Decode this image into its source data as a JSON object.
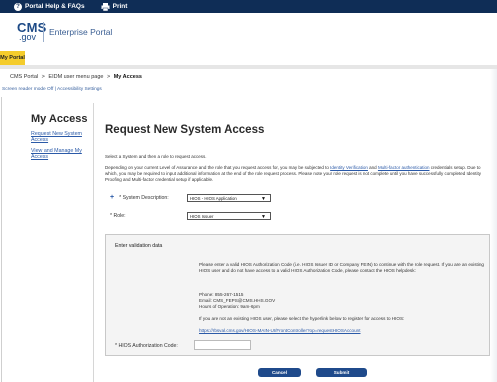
{
  "topbar": {
    "help_label": "Portal Help & FAQs",
    "print_label": "Print"
  },
  "header": {
    "logo_cms": "CMS",
    "logo_gov": ".gov",
    "portal_title": "Enterprise Portal"
  },
  "tabs": {
    "my_portal": "My Portal"
  },
  "breadcrumb": {
    "items": [
      "CMS Portal",
      "EIDM user menu page",
      "My Access"
    ],
    "separator": ">"
  },
  "accessibility": {
    "text": "Screen reader mode Off | Accessibility Settings"
  },
  "sidebar": {
    "title": "My Access",
    "links": [
      "Request New System Access",
      "View and Manage My Access"
    ]
  },
  "main": {
    "title": "Request New System Access",
    "intro": "Select a System and then a role to request access.",
    "para2_a": "Depending on your current Level of Assurance and the role that you request access for, you may be subjected to ",
    "para2_link1": "Identity Verification",
    "para2_b": " and ",
    "para2_link2": "Multi-factor authentication",
    "para2_c": " credentials setup. Due to which, you may be required to input additional information at the end of the role request process. Please note your role request is not complete until you have successfully completed Identity Proofing and Multi-factor credential setup if applicable.",
    "system_label": "System Description:",
    "system_value": "HIOS - HIOS Application",
    "role_label": "Role:",
    "role_value": "HIOS Issuer"
  },
  "validation": {
    "title": "Enter validation data",
    "instructions": "Please enter a valid HIOS Authorization Code (i.e. HIOS Issuer ID or Company FEIN) to continue with the role request. If you are an existing HIOS user and do not have access to a valid HIOS Authorization Code, please contact the HIOS helpdesk:",
    "phone": "Phone: 855-267-1515",
    "email": "Email: CMS_FEPS@CMS.HHS.GOV",
    "hours": "Hours of Operation: 9am-6pm",
    "not_existing": "If you are not an existing HIOS user, please select the hyperlink below to register for access to HIOS:",
    "register_link": "https://rbsval.cms.gov/HIOS-MAIN-UI/FrontController?op=requestHIOSAccount",
    "auth_label": "* HIOS Authorization Code:",
    "auth_value": ""
  },
  "buttons": {
    "cancel": "Cancel",
    "submit": "Submit"
  },
  "colors": {
    "topbar": "#0f2d56",
    "my_portal_tab": "#f4cc2c",
    "link": "#2b5aa8",
    "button": "#1f4a8b"
  }
}
